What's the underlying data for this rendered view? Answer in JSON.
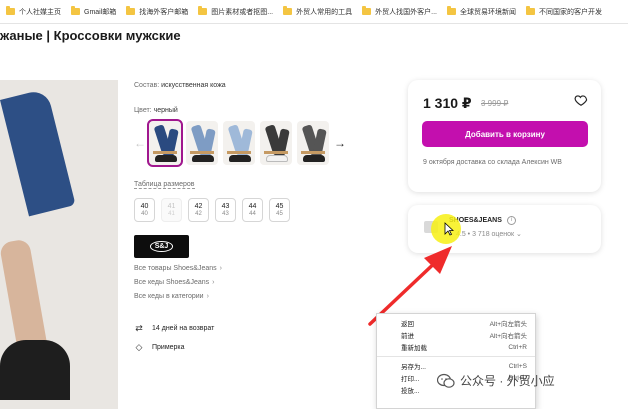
{
  "bookmarks": [
    {
      "label": "个人社媒主页"
    },
    {
      "label": "Gmail邮箱"
    },
    {
      "label": "找海外客户邮箱"
    },
    {
      "label": "图片素材或者抠图..."
    },
    {
      "label": "外贸人常用的工具"
    },
    {
      "label": "外贸人找国外客户..."
    },
    {
      "label": "全球贸易环境新闻"
    },
    {
      "label": "不同国家的客户开发"
    }
  ],
  "page": {
    "title": "жаные | Кроссовки мужские"
  },
  "product": {
    "composition_label": "Состав:",
    "composition_value": "искусственная кожа",
    "color_label": "Цвет:",
    "color_value": "черный",
    "size_table_label": "Таблица размеров",
    "sizes": [
      {
        "size": "40",
        "sub": "40",
        "available": true
      },
      {
        "size": "41",
        "sub": "41",
        "available": false
      },
      {
        "size": "42",
        "sub": "42",
        "available": true
      },
      {
        "size": "43",
        "sub": "43",
        "available": true
      },
      {
        "size": "44",
        "sub": "44",
        "available": true
      },
      {
        "size": "45",
        "sub": "45",
        "available": true
      }
    ],
    "brand_logo_text": "S&J",
    "links": [
      {
        "label": "Все товары Shoes&Jeans"
      },
      {
        "label": "Все кеды Shoes&Jeans"
      },
      {
        "label": "Все кеды в категории"
      }
    ],
    "return_text": "14 дней на возврат",
    "fitting_text": "Примерка"
  },
  "buy": {
    "price": "1 310 ₽",
    "old_price": "3 999 ₽",
    "cart_button": "Добавить в корзину",
    "delivery": "9 октября доставка со склада Алексин WB",
    "accent_color": "#c30fae"
  },
  "seller": {
    "name": "SHOES&JEANS",
    "rating": "4.5 • 3 718 оценок"
  },
  "context_menu": {
    "items": [
      {
        "label": "返回",
        "shortcut": "Alt+向左箭头"
      },
      {
        "label": "前进",
        "shortcut": "Alt+向右箭头"
      },
      {
        "label": "重新加载",
        "shortcut": "Ctrl+R"
      },
      {
        "label": "另存为...",
        "shortcut": "Ctrl+S"
      },
      {
        "label": "打印...",
        "shortcut": "Ctrl+P"
      },
      {
        "label": "投放...",
        "shortcut": ""
      }
    ]
  },
  "watermark": {
    "text": "公众号 · 外贸小应"
  }
}
